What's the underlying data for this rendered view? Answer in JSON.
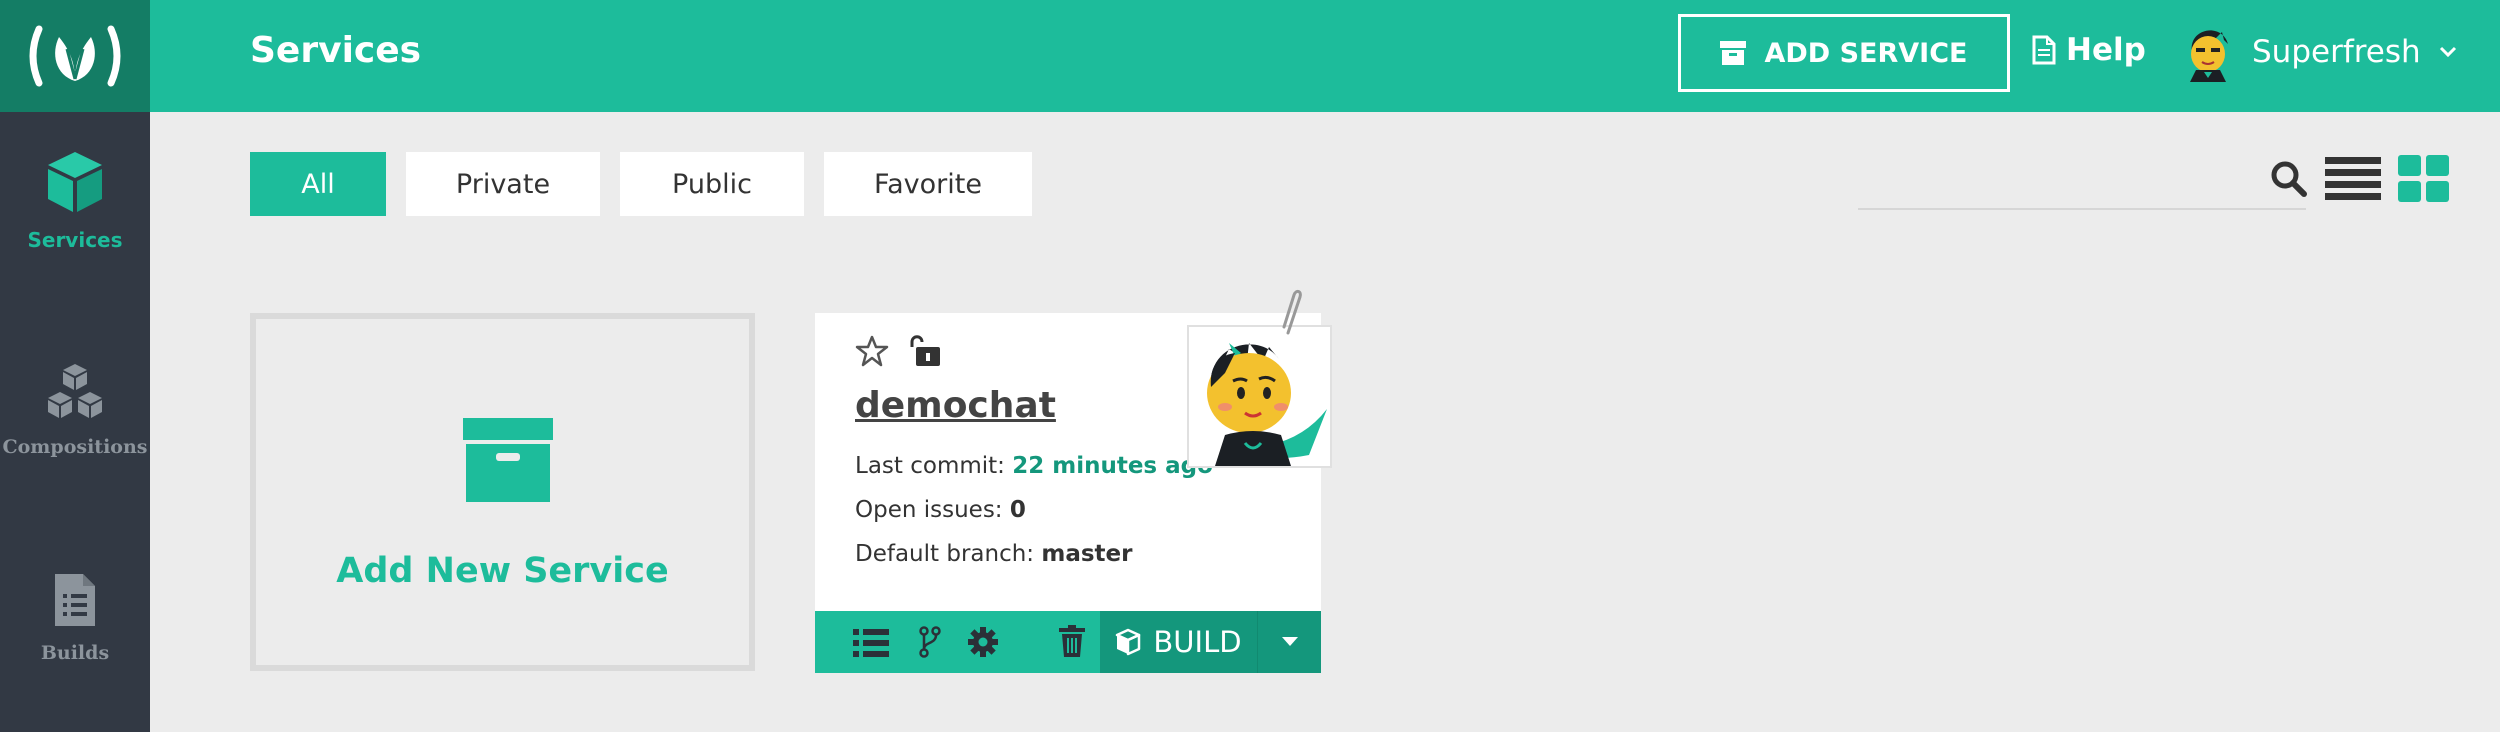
{
  "app": {
    "logo": "logo-icon"
  },
  "sidebar": {
    "items": [
      {
        "label": "Services",
        "icon": "cube-icon",
        "active": true
      },
      {
        "label": "Compositions",
        "icon": "cubes-icon",
        "active": false
      },
      {
        "label": "Builds",
        "icon": "document-icon",
        "active": false
      }
    ]
  },
  "header": {
    "title": "Services",
    "add_service_label": "ADD SERVICE",
    "help_label": "Help",
    "user_name": "Superfresh"
  },
  "filters": [
    {
      "label": "All",
      "active": true
    },
    {
      "label": "Private",
      "active": false
    },
    {
      "label": "Public",
      "active": false
    },
    {
      "label": "Favorite",
      "active": false
    }
  ],
  "search": {
    "placeholder": ""
  },
  "add_card": {
    "label": "Add New Service"
  },
  "service": {
    "name": "demochat",
    "last_commit_label": "Last commit:",
    "last_commit_value": "22 minutes ago",
    "open_issues_label": "Open issues:",
    "open_issues_value": "0",
    "default_branch_label": "Default branch:",
    "default_branch_value": "master",
    "build_label": "BUILD"
  },
  "colors": {
    "accent": "#1dbc9b",
    "accent_dark": "#14977c",
    "sidebar": "#323944",
    "logo_bg": "#147d65"
  }
}
